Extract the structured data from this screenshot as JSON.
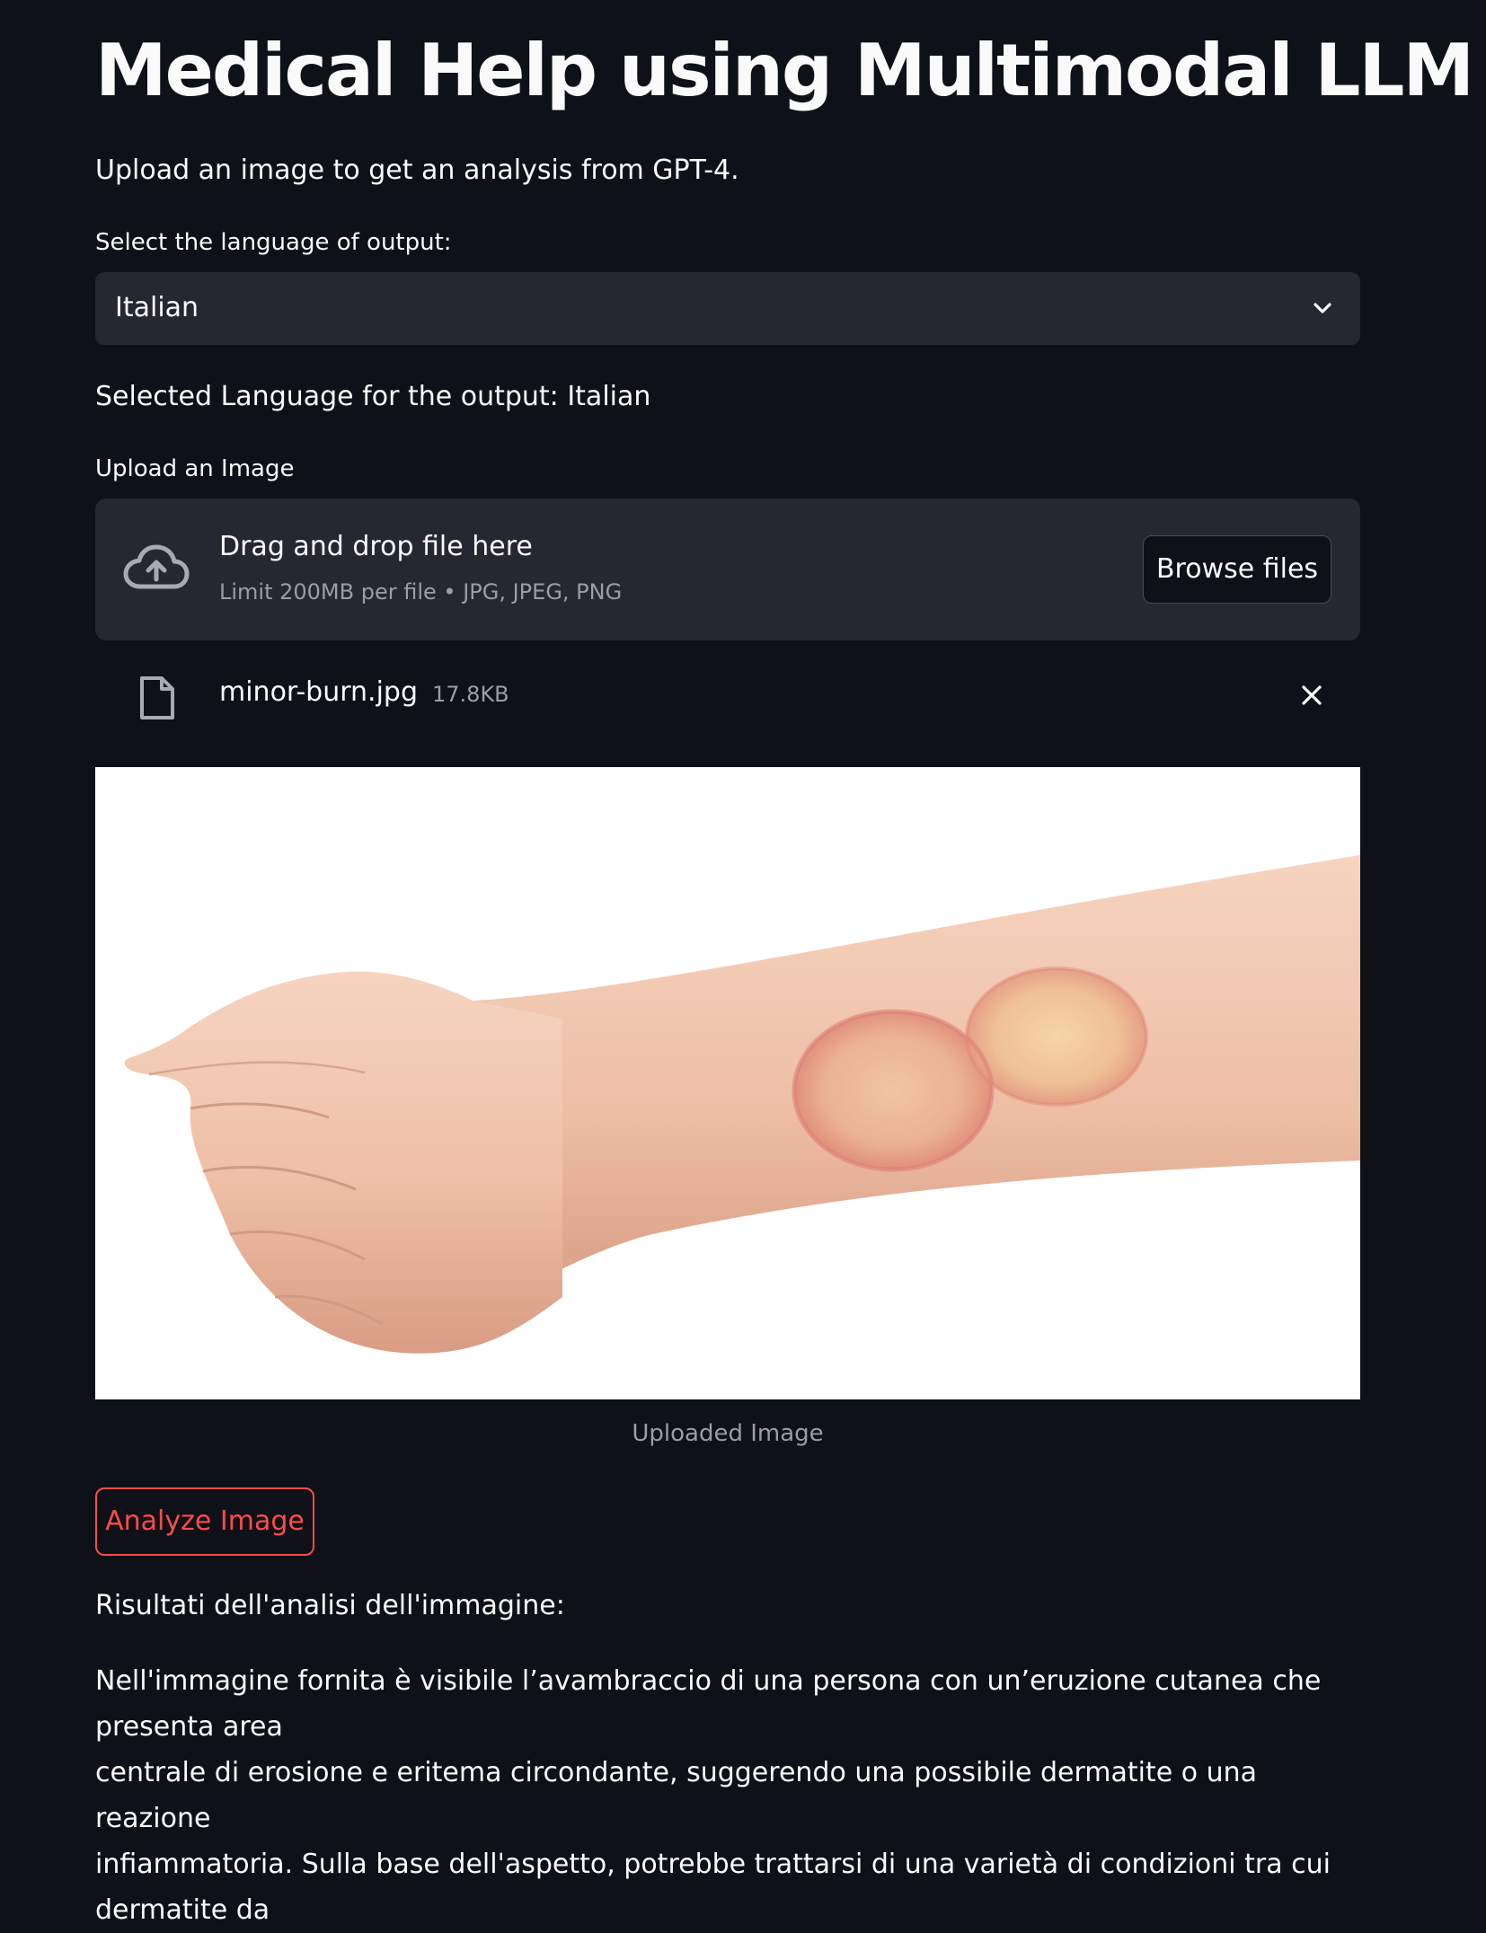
{
  "header": {
    "title": "Medical Help using Multimodal LLM",
    "subtitle": "Upload an image to get an analysis from GPT-4."
  },
  "language_select": {
    "label": "Select the language of output:",
    "value": "Italian",
    "confirmation": "Selected Language for the output: Italian"
  },
  "uploader": {
    "label": "Upload an Image",
    "dropzone_title": "Drag and drop file here",
    "dropzone_limit": "Limit 200MB per file • JPG, JPEG, PNG",
    "browse_label": "Browse files"
  },
  "uploaded_file": {
    "name": "minor-burn.jpg",
    "size": "17.8KB"
  },
  "image": {
    "caption": "Uploaded Image"
  },
  "actions": {
    "analyze_label": "Analyze Image"
  },
  "results": {
    "heading": "Risultati dell'analisi dell'immagine:",
    "lines": [
      "Nell'immagine fornita è visibile l’avambraccio di una persona con un’eruzione cutanea che presenta area",
      "centrale di erosione e eritema circondante, suggerendo una possibile dermatite o una reazione",
      "infiammatoria. Sulla base dell'aspetto, potrebbe trattarsi di una varietà di condizioni tra cui dermatite da"
    ]
  },
  "colors": {
    "background": "#0e1117",
    "widget": "#262730",
    "accent": "#ff4b4b",
    "muted_text": "#9c9da4"
  },
  "icons": [
    "chevron-down-icon",
    "cloud-upload-icon",
    "file-icon",
    "close-icon"
  ]
}
